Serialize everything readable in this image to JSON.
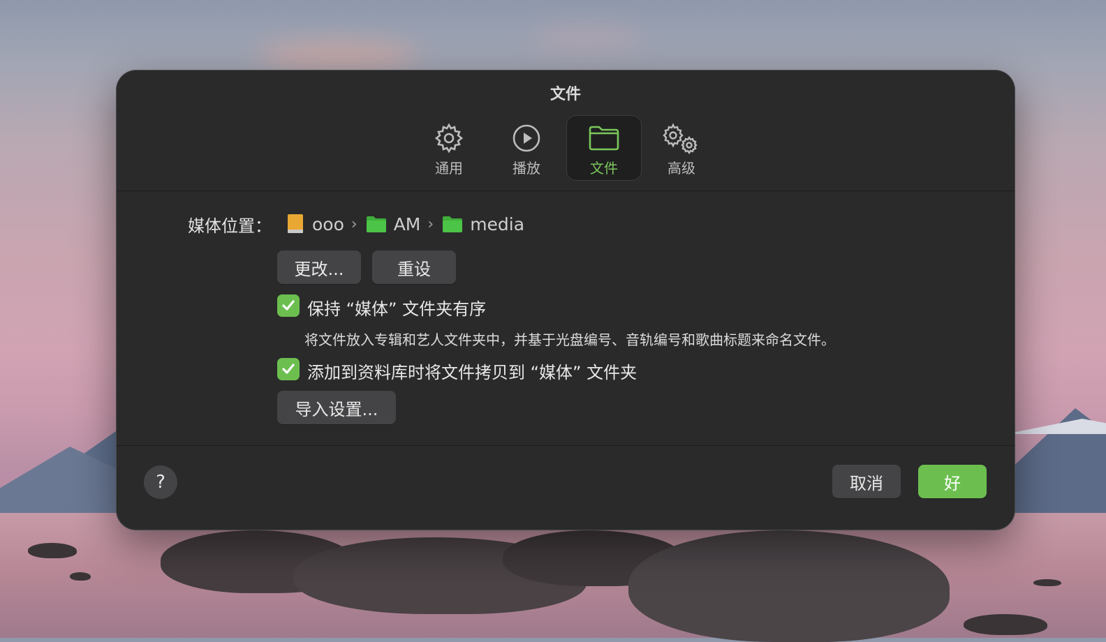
{
  "window": {
    "title": "文件"
  },
  "toolbar": {
    "tabs": [
      {
        "label": "通用",
        "icon": "gear-icon"
      },
      {
        "label": "播放",
        "icon": "play-icon"
      },
      {
        "label": "文件",
        "icon": "folder-icon",
        "selected": true
      },
      {
        "label": "高级",
        "icon": "gears-icon"
      }
    ]
  },
  "media_location": {
    "label": "媒体位置：",
    "path": [
      {
        "name": "ooo",
        "icon": "drive-icon"
      },
      {
        "name": "AM",
        "icon": "folder-icon"
      },
      {
        "name": "media",
        "icon": "folder-icon"
      }
    ],
    "change_label": "更改...",
    "reset_label": "重设"
  },
  "options": {
    "keep_organized": {
      "label": "保持 “媒体” 文件夹有序",
      "checked": true
    },
    "keep_organized_desc": "将文件放入专辑和艺人文件夹中，并基于光盘编号、音轨编号和歌曲标题来命名文件。",
    "copy_on_add": {
      "label": "添加到资料库时将文件拷贝到 “媒体” 文件夹",
      "checked": true
    },
    "import_settings_label": "导入设置..."
  },
  "footer": {
    "help_label": "?",
    "cancel_label": "取消",
    "ok_label": "好"
  },
  "colors": {
    "accent": "#6cbf4f",
    "window_bg": "#2a2a2b",
    "button_bg": "#444446"
  }
}
